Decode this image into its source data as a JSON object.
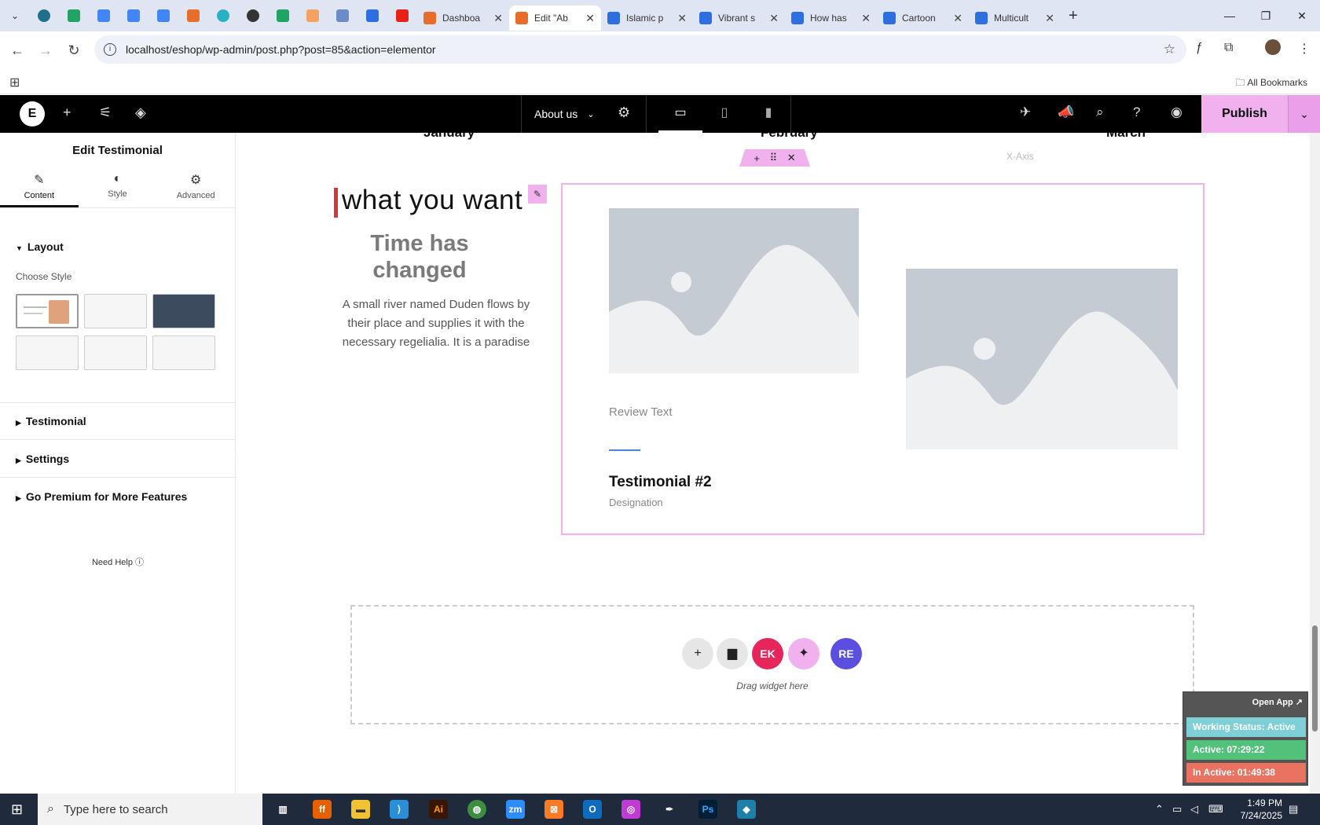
{
  "browser": {
    "tabs": [
      {
        "title": "Dashboa",
        "color": "#e86c2a",
        "active": false
      },
      {
        "title": "Edit \"Ab",
        "color": "#e86c2a",
        "active": true
      },
      {
        "title": "Islamic p",
        "color": "#2d6fe0",
        "active": false
      },
      {
        "title": "Vibrant s",
        "color": "#2d6fe0",
        "active": false
      },
      {
        "title": "How has",
        "color": "#2d6fe0",
        "active": false
      },
      {
        "title": "Cartoon",
        "color": "#2d6fe0",
        "active": false
      },
      {
        "title": "Multicult",
        "color": "#2d6fe0",
        "active": false
      }
    ],
    "url": "localhost/eshop/wp-admin/post.php?post=85&action=elementor",
    "bookmarks_label": "All Bookmarks"
  },
  "editor": {
    "page_name": "About us",
    "publish_label": "Publish",
    "panel": {
      "title": "Edit Testimonial",
      "tabs": [
        "Content",
        "Style",
        "Advanced"
      ],
      "layout_label": "Layout",
      "choose_style_label": "Choose Style",
      "sections": [
        "Testimonial",
        "Settings",
        "Go Premium for More Features"
      ],
      "need_help": "Need Help"
    },
    "canvas": {
      "months": [
        "January",
        "February",
        "March"
      ],
      "x_axis": "X-Axis",
      "heading": "what you want",
      "subheading": "Time has changed",
      "paragraph": "A small river named Duden flows by their place and supplies it with the necessary regelialia. It is a paradise",
      "review_text": "Review Text",
      "testimonial_name": "Testimonial #2",
      "designation": "Designation",
      "drag_label": "Drag widget here"
    }
  },
  "tracker": {
    "open_app": "Open App ↗",
    "working_status": "Working Status: Active",
    "active": "Active: 07:29:22",
    "inactive": "In Active: 01:49:38"
  },
  "taskbar": {
    "search_placeholder": "Type here to search",
    "time": "1:49 PM",
    "date": "7/24/2025"
  }
}
